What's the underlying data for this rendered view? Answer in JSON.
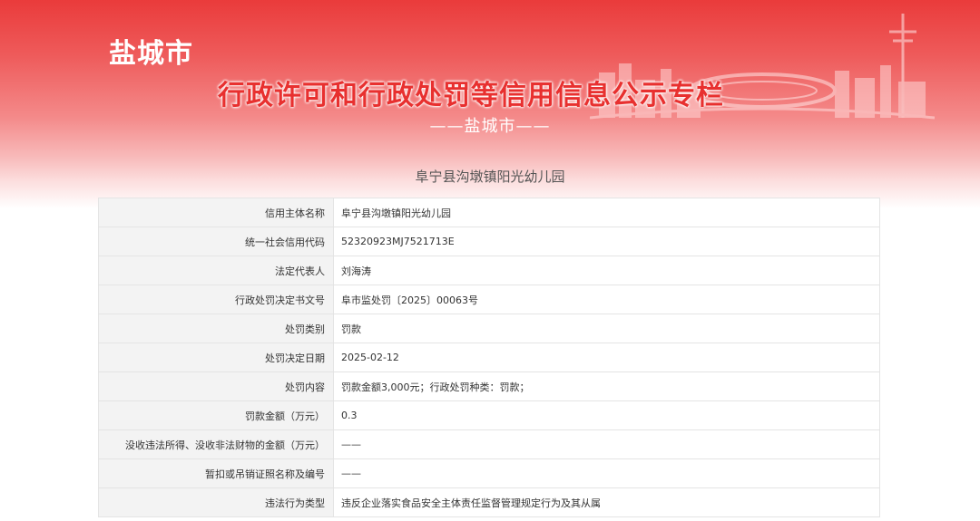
{
  "header": {
    "city": "盐城市",
    "title": "行政许可和行政处罚等信用信息公示专栏",
    "subtitle": "——盐城市——"
  },
  "entity_title": "阜宁县沟墩镇阳光幼儿园",
  "rows": [
    {
      "label": "信用主体名称",
      "value": "阜宁县沟墩镇阳光幼儿园"
    },
    {
      "label": "统一社会信用代码",
      "value": "52320923MJ7521713E"
    },
    {
      "label": "法定代表人",
      "value": "刘海涛"
    },
    {
      "label": "行政处罚决定书文号",
      "value": "阜市监处罚〔2025〕00063号"
    },
    {
      "label": "处罚类别",
      "value": "罚款"
    },
    {
      "label": "处罚决定日期",
      "value": "2025-02-12"
    },
    {
      "label": "处罚内容",
      "value": "罚款金额3,000元；行政处罚种类：罚款；"
    },
    {
      "label": "罚款金额（万元）",
      "value": "0.3"
    },
    {
      "label": "没收违法所得、没收非法财物的金额（万元）",
      "value": "——"
    },
    {
      "label": "暂扣或吊销证照名称及编号",
      "value": "——"
    },
    {
      "label": "违法行为类型",
      "value": "违反企业落实食品安全主体责任监督管理规定行为及其从属"
    }
  ]
}
